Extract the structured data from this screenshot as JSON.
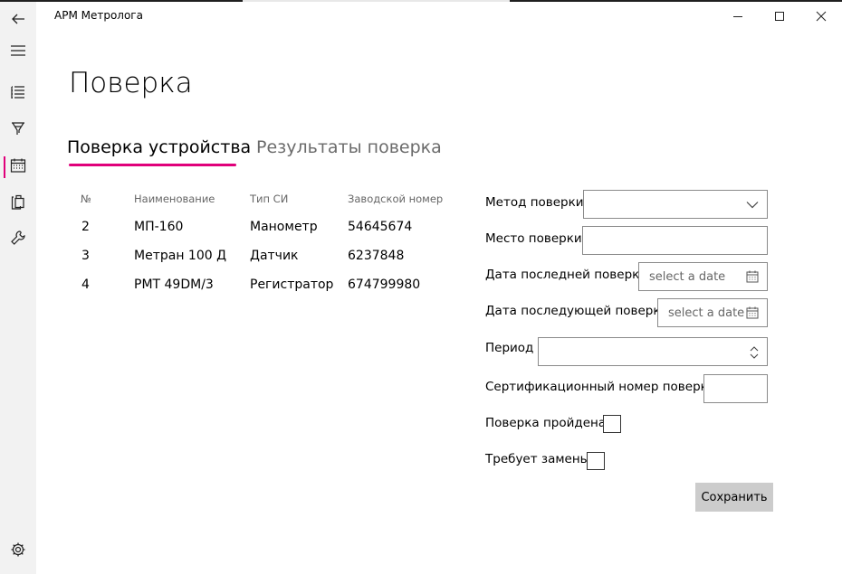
{
  "window": {
    "title": "АРМ Метролога"
  },
  "page": {
    "title": "Поверка"
  },
  "tabs": [
    {
      "label": "Поверка устройства",
      "active": true
    },
    {
      "label": "Результаты поверка",
      "active": false
    }
  ],
  "table": {
    "headers": [
      "№",
      "Наименование",
      "Тип СИ",
      "Заводской номер"
    ],
    "rows": [
      [
        "2",
        "МП-160",
        "Манометр",
        "54645674"
      ],
      [
        "3",
        "Метран 100 Д",
        "Датчик",
        "6237848"
      ],
      [
        "4",
        "РМТ 49DM/3",
        "Регистратор",
        "674799980"
      ]
    ]
  },
  "form": {
    "method_label": "Метод поверки",
    "method_value": "",
    "place_label": "Место поверки",
    "place_value": "",
    "last_date_label": "Дата последней поверки",
    "last_date_placeholder": "select a date",
    "next_date_label": "Дата последующей поверки",
    "next_date_placeholder": "select a date",
    "period_label": "Период",
    "period_value": "",
    "cert_label": "Сертификационный номер поверки",
    "cert_value": "",
    "passed_label": "Поверка пройдена",
    "passed_checked": false,
    "replace_label": "Требует замены",
    "replace_checked": false,
    "save_label": "Сохранить"
  },
  "nav": {
    "items": [
      {
        "icon": "back-arrow-icon"
      },
      {
        "icon": "hamburger-menu-icon"
      },
      {
        "icon": "list-icon"
      },
      {
        "icon": "filter-icon"
      },
      {
        "icon": "calendar-icon",
        "selected": true
      },
      {
        "icon": "clipboard-icon"
      },
      {
        "icon": "wrench-icon"
      },
      {
        "icon": "settings-gear-icon"
      }
    ]
  },
  "colors": {
    "accent": "#e0007a",
    "rail_bg": "#f2f2f2",
    "button_bg": "#cccccc"
  }
}
